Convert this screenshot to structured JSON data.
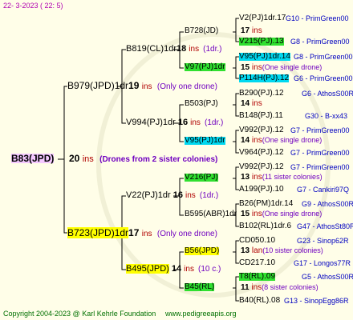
{
  "header": {
    "date": "22-  3-2023 (  22:  5)"
  },
  "footer": {
    "copyright": "Copyright 2004-2023 @ Karl Kehrle Foundation",
    "site": "www.pedigreeapis.org"
  },
  "root": {
    "id": "B83(JPD)",
    "num": "20",
    "ins": "ins",
    "note": "(Drones from 2 sister colonies)"
  },
  "g1": [
    {
      "id": "B979(JPD)1dr",
      "num": "19",
      "ins": "ins",
      "note": "(Only one drone)"
    },
    {
      "id": "B723(JPD)1dr",
      "num": "17",
      "ins": "ins",
      "note": "(Only one drone)"
    }
  ],
  "g2": [
    {
      "id": "B819(CL)1dr",
      "num": "18",
      "ins": "ins",
      "note": "(1dr.)"
    },
    {
      "id": "V994(PJ)1dr",
      "num": "16",
      "ins": "ins",
      "note": "(1dr.)"
    },
    {
      "id": "V22(PJ)1dr",
      "num": "16",
      "ins": "ins",
      "note": "(1dr.)"
    },
    {
      "id": "B495(JPD)",
      "num": "14",
      "ins": "ins",
      "note": "(10 c.)"
    }
  ],
  "g3": [
    {
      "id": "B728(JD)",
      "num": "17",
      "ins": "ins",
      "note": ""
    },
    {
      "id": "V97(PJ)1dr",
      "num": "15",
      "ins": "ins",
      "note": "(One single drone)"
    },
    {
      "id": "B503(PJ)",
      "num": "14",
      "ins": "ins",
      "note": ""
    },
    {
      "id": "V95(PJ)1dr",
      "num": "14",
      "ins": "ins",
      "note": "(One single drone)"
    },
    {
      "id": "V216(PJ)",
      "num": "13",
      "ins": "ins",
      "note": "(11 sister colonies)"
    },
    {
      "id": "B595(ABR)1dr",
      "num": "15",
      "ins": "ins",
      "note": "(One single drone)"
    },
    {
      "id": "B56(JPD)",
      "num": "13",
      "ins": "lan",
      "note": "(10 sister colonies)"
    },
    {
      "id": "B45(RL)",
      "num": "11",
      "ins": "ins",
      "note": "(8 sister colonies)"
    }
  ],
  "g4": [
    {
      "id": "V2(PJ)1dr.17",
      "src": "G10 - PrimGreen00"
    },
    {
      "id": "V215(PJ).13",
      "src": "G8 - PrimGreen00"
    },
    {
      "id": "V95(PJ)1dr.14",
      "src": "G8 - PrimGreen00"
    },
    {
      "id": "P114H(PJ).12",
      "src": "G6 - PrimGreen00"
    },
    {
      "id": "B290(PJ).12",
      "src": "G6 - AthosS00R"
    },
    {
      "id": "B148(PJ).11",
      "src": "G30 - B-xx43"
    },
    {
      "id": "V992(PJ).12",
      "src": "G7 - PrimGreen00"
    },
    {
      "id": "V964(PJ).12",
      "src": "G7 - PrimGreen00"
    },
    {
      "id": "V992(PJ).12",
      "src": "G7 - PrimGreen00"
    },
    {
      "id": "A199(PJ).10",
      "src": "G7 - Cankiri97Q"
    },
    {
      "id": "B26(PM)1dr.14",
      "src": "G9 - AthosS00R"
    },
    {
      "id": "B102(RL)1dr.6",
      "src": "G47 - AthosSt80R"
    },
    {
      "id": "CD050.10",
      "src": "G23 - Sinop62R"
    },
    {
      "id": "CD217.10",
      "src": "G17 - Longos77R"
    },
    {
      "id": "T8(RL).09",
      "src": "G5 - AthosS00R"
    },
    {
      "id": "B40(RL).08",
      "src": "G13 - SinopEgg86R"
    }
  ]
}
